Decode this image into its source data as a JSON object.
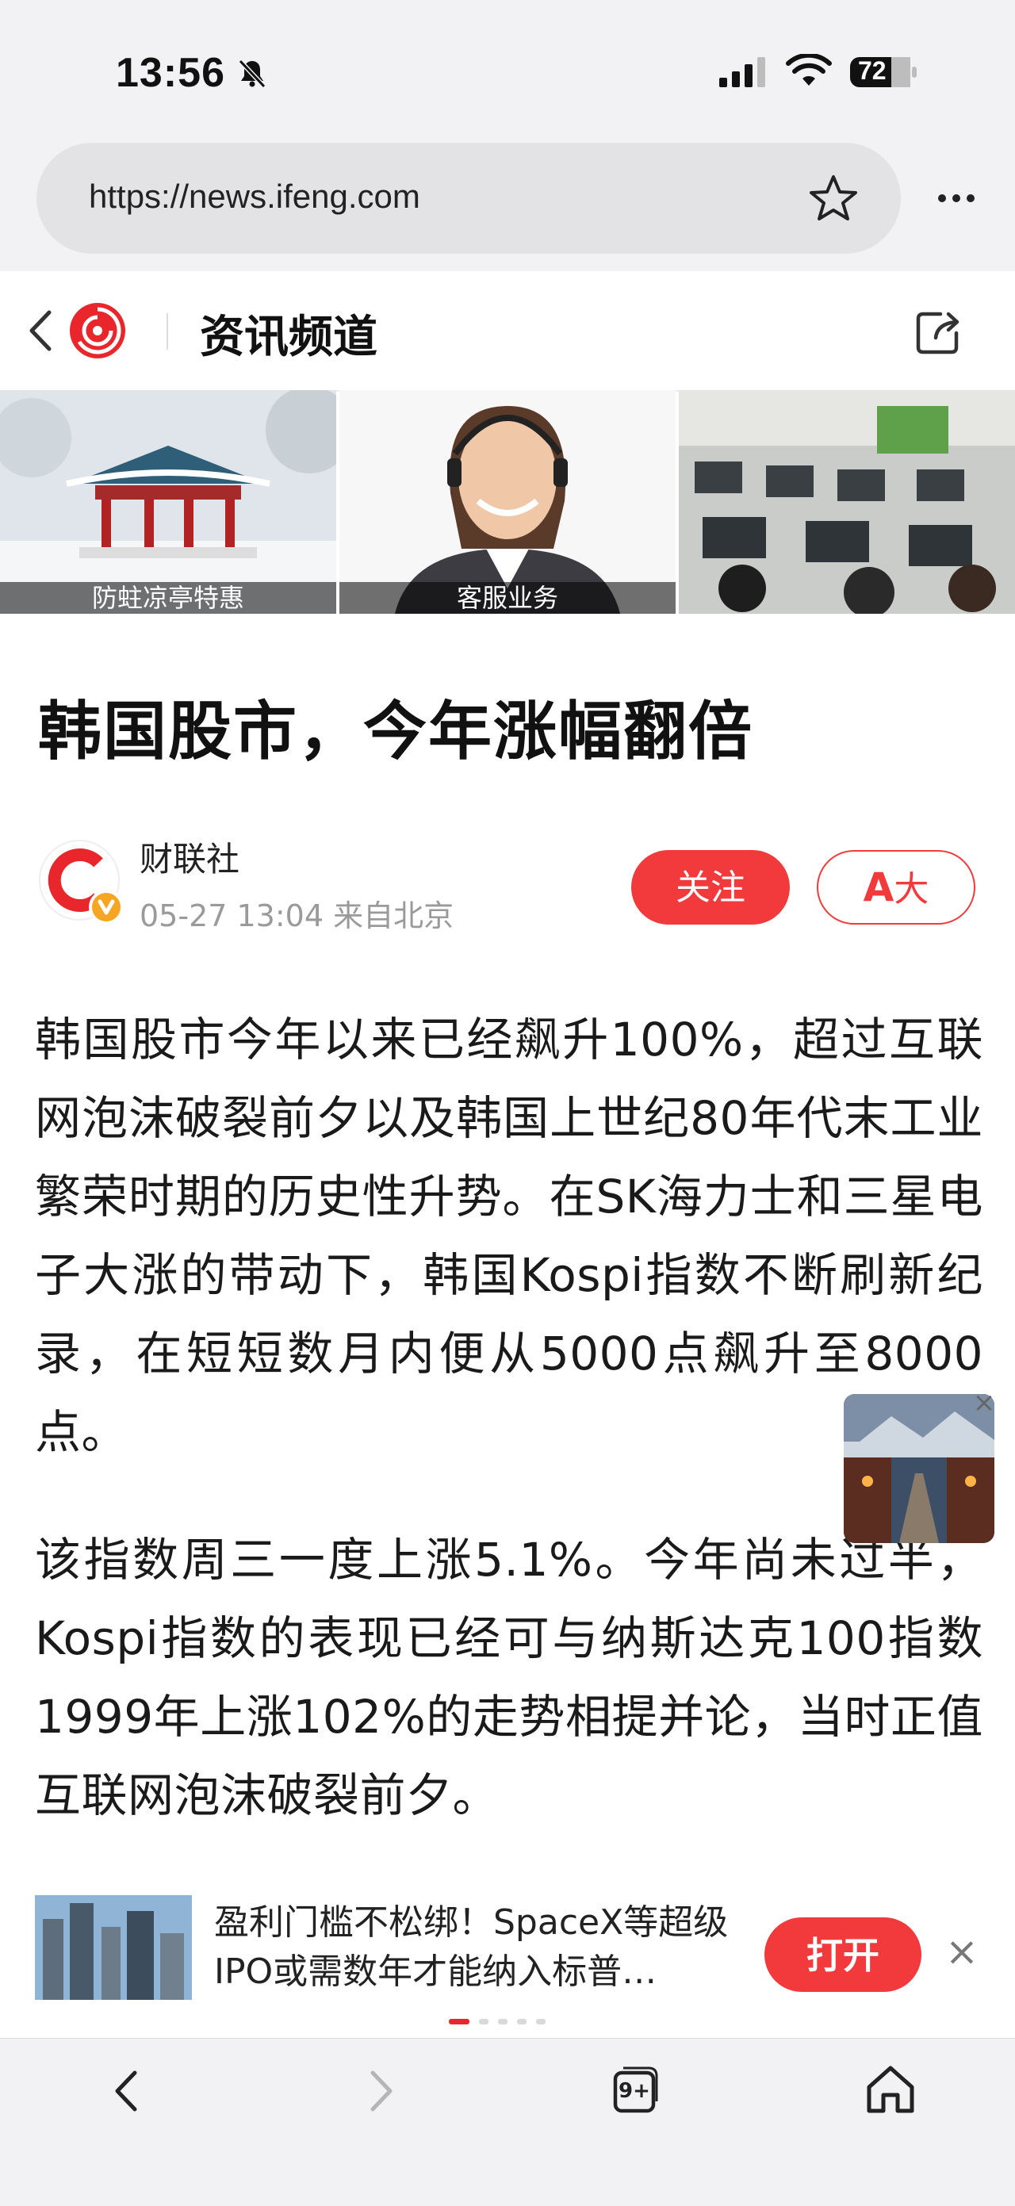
{
  "status": {
    "time": "13:56",
    "battery": "72"
  },
  "browser": {
    "url": "https://news.ifeng.com"
  },
  "channel": {
    "title": "资讯频道"
  },
  "banners": [
    {
      "caption": "防蛀凉亭特惠"
    },
    {
      "caption": "客服业务"
    },
    {
      "caption": ""
    }
  ],
  "article": {
    "headline": "韩国股市，今年涨幅翻倍",
    "author": "财联社",
    "meta": "05-27 13:04 来自北京",
    "follow_label": "关注",
    "font_label_a": "A",
    "font_label_big": "大",
    "paragraphs": [
      "韩国股市今年以来已经飙升100%，超过互联网泡沫破裂前夕以及韩国上世纪80年代末工业繁荣时期的历史性升势。在SK海力士和三星电子大涨的带动下，韩国Kospi指数不断刷新纪录，在短短数月内便从5000点飙升至8000点。",
      "该指数周三一度上涨5.1%。今年尚未过半，Kospi指数的表现已经可与纳斯达克100指数1999年上涨102%的走势相提并论，当时正值互联网泡沫破裂前夕。"
    ]
  },
  "promo": {
    "text": "盈利门槛不松绑！SpaceX等超级IPO或需数年才能纳入标普…",
    "open_label": "打开",
    "close_glyph": "×"
  },
  "toolbar": {
    "tabs_count": "9+"
  },
  "colors": {
    "accent": "#f23a3c",
    "bar_bg": "#f2f2f4"
  }
}
